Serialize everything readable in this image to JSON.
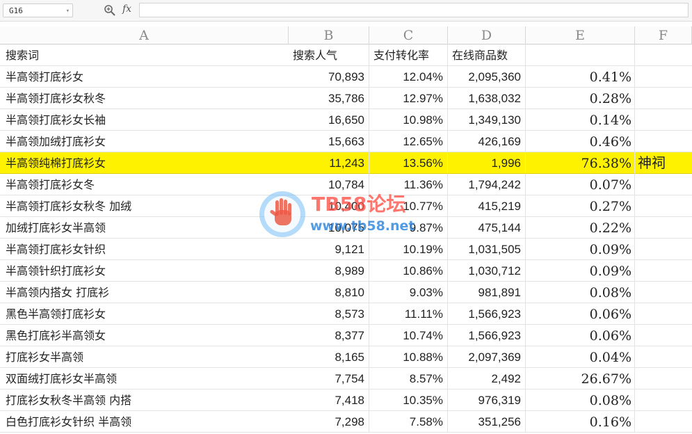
{
  "formula_bar": {
    "name_box": "G16",
    "fx_label": "fx",
    "formula_value": ""
  },
  "columns": [
    "A",
    "B",
    "C",
    "D",
    "E",
    "F"
  ],
  "header": {
    "a": "搜索词",
    "b": "搜索人气",
    "c": "支付转化率",
    "d": "在线商品数",
    "e": "",
    "f": ""
  },
  "rows": [
    {
      "a": "半高领打底衫女",
      "b": "70,893",
      "c": "12.04%",
      "d": "2,095,360",
      "e": "0.41%",
      "f": ""
    },
    {
      "a": "半高领打底衫女秋冬",
      "b": "35,786",
      "c": "12.97%",
      "d": "1,638,032",
      "e": "0.28%",
      "f": ""
    },
    {
      "a": "半高领打底衫女长袖",
      "b": "16,650",
      "c": "10.98%",
      "d": "1,349,130",
      "e": "0.14%",
      "f": ""
    },
    {
      "a": "半高领加绒打底衫女",
      "b": "15,663",
      "c": "12.65%",
      "d": "426,169",
      "e": "0.46%",
      "f": ""
    },
    {
      "a": "半高领纯棉打底衫女",
      "b": "11,243",
      "c": "13.56%",
      "d": "1,996",
      "e": "76.38%",
      "f": "神祠"
    },
    {
      "a": "半高领打底衫女冬",
      "b": "10,784",
      "c": "11.36%",
      "d": "1,794,242",
      "e": "0.07%",
      "f": ""
    },
    {
      "a": "半高领打底衫女秋冬 加绒",
      "b": "10,400",
      "c": "10.77%",
      "d": "415,219",
      "e": "0.27%",
      "f": ""
    },
    {
      "a": "加绒打底衫女半高领",
      "b": "10,075",
      "c": "9.87%",
      "d": "475,144",
      "e": "0.22%",
      "f": ""
    },
    {
      "a": "半高领打底衫女针织",
      "b": "9,121",
      "c": "10.19%",
      "d": "1,031,505",
      "e": "0.09%",
      "f": ""
    },
    {
      "a": "半高领针织打底衫女",
      "b": "8,989",
      "c": "10.86%",
      "d": "1,030,712",
      "e": "0.09%",
      "f": ""
    },
    {
      "a": "半高领内搭女 打底衫",
      "b": "8,810",
      "c": "9.03%",
      "d": "981,891",
      "e": "0.08%",
      "f": ""
    },
    {
      "a": "黑色半高领打底衫女",
      "b": "8,573",
      "c": "11.11%",
      "d": "1,566,923",
      "e": "0.06%",
      "f": ""
    },
    {
      "a": "黑色打底衫半高领女",
      "b": "8,377",
      "c": "10.74%",
      "d": "1,566,923",
      "e": "0.06%",
      "f": ""
    },
    {
      "a": "打底衫女半高领",
      "b": "8,165",
      "c": "10.88%",
      "d": "2,097,369",
      "e": "0.04%",
      "f": ""
    },
    {
      "a": "双面绒打底衫女半高领",
      "b": "7,754",
      "c": "8.57%",
      "d": "2,492",
      "e": "26.67%",
      "f": ""
    },
    {
      "a": "打底衫女秋冬半高领 内搭",
      "b": "7,418",
      "c": "10.35%",
      "d": "976,319",
      "e": "0.08%",
      "f": ""
    },
    {
      "a": "白色打底衫女针织 半高领",
      "b": "7,298",
      "c": "7.58%",
      "d": "351,256",
      "e": "0.16%",
      "f": ""
    }
  ],
  "highlight_row_index": 4,
  "highlight_color": "#fff200",
  "watermark": {
    "title": "TB58论坛",
    "url": "www.tb58.net",
    "icon": "hand-icon"
  }
}
